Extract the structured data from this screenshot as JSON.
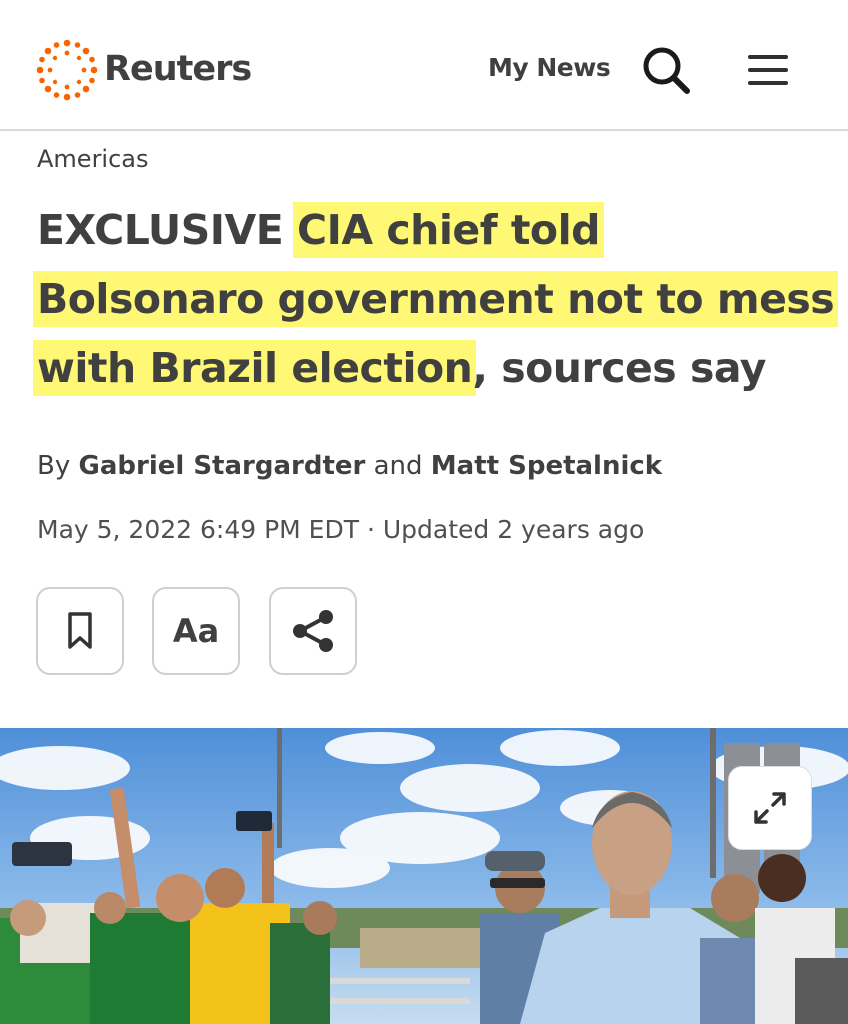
{
  "header": {
    "brand": "Reuters",
    "my_news_label": "My News",
    "search_icon": "search-icon",
    "menu_icon": "hamburger-menu-icon",
    "logo_color": "#fa6400"
  },
  "article": {
    "section": "Americas",
    "headline": {
      "line1_prefix": "EXCLUSIVE ",
      "line1_highlight": "CIA chief told",
      "line2_highlight": "Bolsonaro government not to mess",
      "line3_highlight": "with Brazil election",
      "line3_rest": ", sources say"
    },
    "highlight_color": "#fff646",
    "byline": {
      "prefix": "By ",
      "author1": "Gabriel Stargardter",
      "joiner": " and ",
      "author2": "Matt Spetalnick"
    },
    "dateline": "May 5, 2022 6:49 PM EDT · Updated 2 years ago",
    "actions": {
      "bookmark_icon": "bookmark-icon",
      "text_size_label": "Aa",
      "share_icon": "share-icon"
    }
  },
  "photo": {
    "expand_icon": "expand-icon"
  }
}
